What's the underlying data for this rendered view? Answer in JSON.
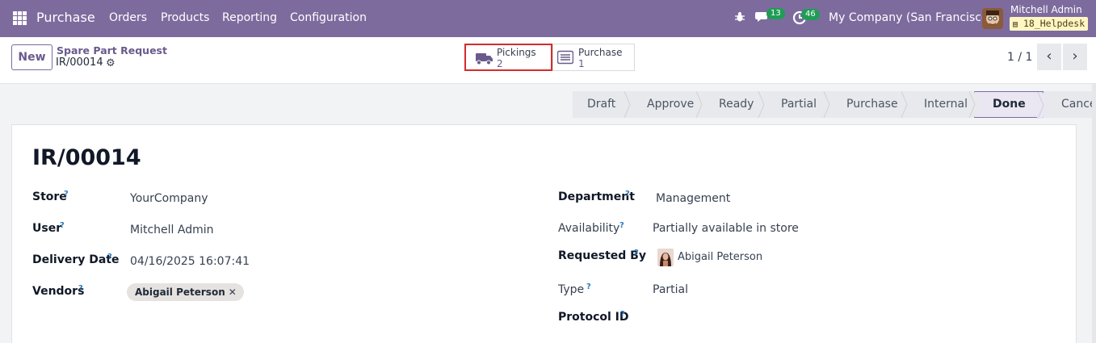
{
  "topbar": {
    "app_name": "Purchase",
    "menu": [
      "Orders",
      "Products",
      "Reporting",
      "Configuration"
    ],
    "messages_count": "13",
    "activities_count": "46",
    "company": "My Company (San Francisco)",
    "user_name": "Mitchell Admin",
    "database": "18_Helpdesk"
  },
  "breadcrumb": {
    "new_label": "New",
    "parent": "Spare Part Request",
    "current": "IR/00014"
  },
  "smart_buttons": [
    {
      "label": "Pickings",
      "value": "2",
      "icon": "truck-icon"
    },
    {
      "label": "Purchase",
      "value": "1",
      "icon": "list-icon"
    }
  ],
  "pager": {
    "text": "1 / 1"
  },
  "status_stages": [
    "Draft",
    "Approve",
    "Ready",
    "Partial",
    "Purchase",
    "Internal",
    "Done",
    "Cancel"
  ],
  "status_current": "Done",
  "form": {
    "title": "IR/00014",
    "left": [
      {
        "label": "Store",
        "value": "YourCompany"
      },
      {
        "label": "User",
        "value": "Mitchell Admin"
      },
      {
        "label": "Delivery Date",
        "value": "04/16/2025 16:07:41"
      },
      {
        "label": "Vendors",
        "value": "Abigail Peterson"
      }
    ],
    "right": [
      {
        "label": "Department",
        "value": "Management"
      },
      {
        "label": "Availability",
        "value": "Partially available in store"
      },
      {
        "label": "Requested By",
        "value": "Abigail Peterson"
      },
      {
        "label": "Type",
        "value": "Partial"
      },
      {
        "label": "Protocol ID",
        "value": ""
      }
    ],
    "help_mark": "?"
  },
  "colors": {
    "accent": "#7d6b9e",
    "highlight_border": "#d52b2b",
    "badge": "#1f9d55"
  }
}
